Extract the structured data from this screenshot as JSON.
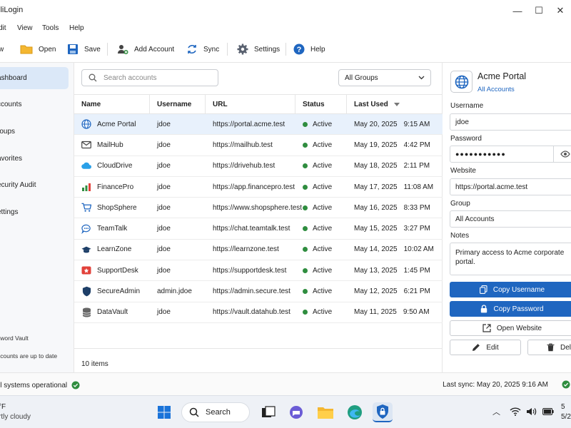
{
  "app": {
    "title": "lliLogin"
  },
  "menu": [
    "dit",
    "View",
    "Tools",
    "Help"
  ],
  "toolbar": {
    "new_label": "w",
    "open_label": "Open",
    "save_label": "Save",
    "add_label": "Add Account",
    "sync_label": "Sync",
    "settings_label": "Settings",
    "help_label": "Help"
  },
  "sidebar": {
    "items": [
      {
        "label": "ashboard",
        "active": true
      },
      {
        "label": "ccounts"
      },
      {
        "label": "roups"
      },
      {
        "label": "avorites"
      },
      {
        "label": "ecurity Audit"
      },
      {
        "label": "ettings"
      }
    ],
    "footer_vault": "sword Vault",
    "footer_status": "ccounts are up to date"
  },
  "main": {
    "search_placeholder": "Search accounts",
    "group_filter": "All Groups",
    "columns": [
      "Name",
      "Username",
      "URL",
      "Status",
      "Last Used"
    ],
    "rows": [
      {
        "icon": "globe-icon",
        "name": "Acme Portal",
        "user": "jdoe",
        "url": "https://portal.acme.test",
        "status": "Active",
        "date": "May 20, 2025",
        "time": "9:15 AM",
        "selected": true
      },
      {
        "icon": "mail-icon",
        "name": "MailHub",
        "user": "jdoe",
        "url": "https://mailhub.test",
        "status": "Active",
        "date": "May 19, 2025",
        "time": "4:42 PM"
      },
      {
        "icon": "cloud-icon",
        "name": "CloudDrive",
        "user": "jdoe",
        "url": "https://drivehub.test",
        "status": "Active",
        "date": "May 18, 2025",
        "time": "2:11 PM"
      },
      {
        "icon": "chart-icon",
        "name": "FinancePro",
        "user": "jdoe",
        "url": "https://app.financepro.test",
        "status": "Active",
        "date": "May 17, 2025",
        "time": "11:08 AM"
      },
      {
        "icon": "cart-icon",
        "name": "ShopSphere",
        "user": "jdoe",
        "url": "https://www.shopsphere.test",
        "status": "Active",
        "date": "May 16, 2025",
        "time": "8:33 PM"
      },
      {
        "icon": "chat-icon",
        "name": "TeamTalk",
        "user": "jdoe",
        "url": "https://chat.teamtalk.test",
        "status": "Active",
        "date": "May 15, 2025",
        "time": "3:27 PM"
      },
      {
        "icon": "graduation-cap-icon",
        "name": "LearnZone",
        "user": "jdoe",
        "url": "https://learnzone.test",
        "status": "Active",
        "date": "May 14, 2025",
        "time": "10:02 AM"
      },
      {
        "icon": "support-icon",
        "name": "SupportDesk",
        "user": "jdoe",
        "url": "https://supportdesk.test",
        "status": "Active",
        "date": "May 13, 2025",
        "time": "1:45 PM"
      },
      {
        "icon": "shield-icon",
        "name": "SecureAdmin",
        "user": "admin.jdoe",
        "url": "https://admin.secure.test",
        "status": "Active",
        "date": "May 12, 2025",
        "time": "6:21 PM"
      },
      {
        "icon": "database-icon",
        "name": "DataVault",
        "user": "jdoe",
        "url": "https://vault.datahub.test",
        "status": "Active",
        "date": "May 11, 2025",
        "time": "9:50 AM"
      }
    ],
    "items_count": "10 items"
  },
  "details": {
    "title": "Acme Portal",
    "group_link": "All Accounts",
    "username_label": "Username",
    "username": "jdoe",
    "password_label": "Password",
    "password_masked": "●●●●●●●●●●●",
    "website_label": "Website",
    "website": "https://portal.acme.test",
    "group_label": "Group",
    "group": "All Accounts",
    "notes_label": "Notes",
    "notes": "Primary access to Acme corporate portal.",
    "copy_username": "Copy Username",
    "copy_password": "Copy Password",
    "open_website": "Open Website",
    "edit": "Edit",
    "delete": "Del"
  },
  "status": {
    "left": "ll systems operational",
    "sync": "Last sync:  May 20, 2025  9:16 AM"
  },
  "taskbar": {
    "temp": "°F",
    "weather": "rtly cloudy",
    "search": "Search",
    "date": "5/2"
  },
  "colors": {
    "accent": "#1f66c0",
    "success": "#2f8d3f",
    "selected_row": "#e8f1fc",
    "sidebar_active": "#dbe8f8"
  }
}
